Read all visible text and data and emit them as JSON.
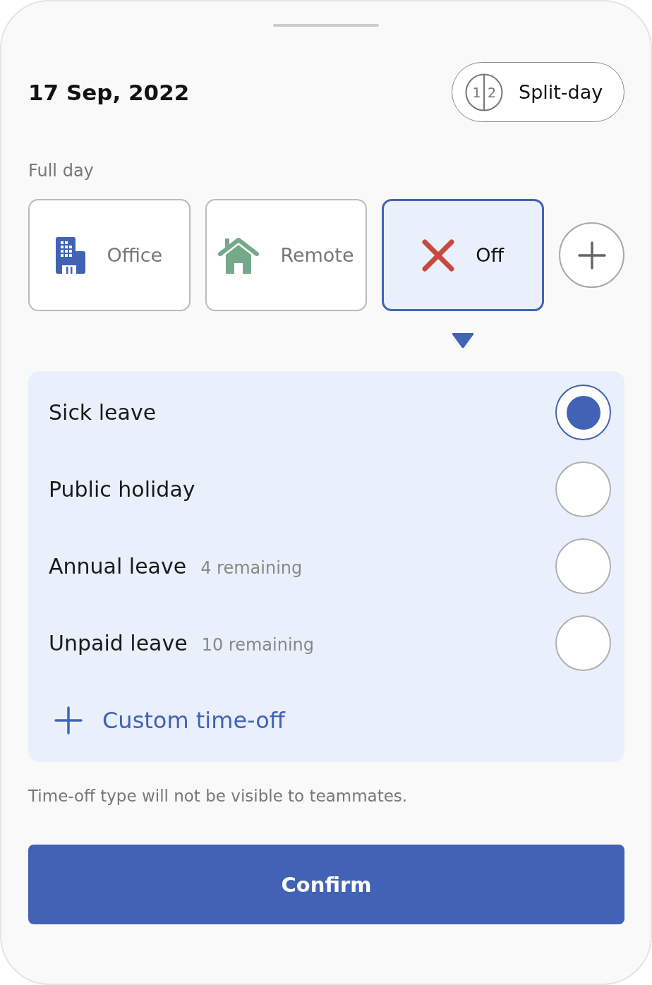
{
  "header": {
    "date": "17 Sep, 2022",
    "split_button": {
      "label": "Split-day",
      "digits": [
        "1",
        "2"
      ]
    }
  },
  "section_label": "Full day",
  "work_types": [
    {
      "kind": "office",
      "label": "Office",
      "selected": false
    },
    {
      "kind": "remote",
      "label": "Remote",
      "selected": false
    },
    {
      "kind": "off",
      "label": "Off",
      "selected": true
    }
  ],
  "leave_types": [
    {
      "label": "Sick leave",
      "selected": true
    },
    {
      "label": "Public holiday",
      "selected": false
    },
    {
      "label": "Annual leave",
      "remaining": "4 remaining",
      "selected": false
    },
    {
      "label": "Unpaid leave",
      "remaining": "10 remaining",
      "selected": false
    }
  ],
  "custom_action": {
    "label": "Custom time-off"
  },
  "note": "Time-off type will not be visible to teammates.",
  "confirm_button": {
    "label": "Confirm"
  }
}
